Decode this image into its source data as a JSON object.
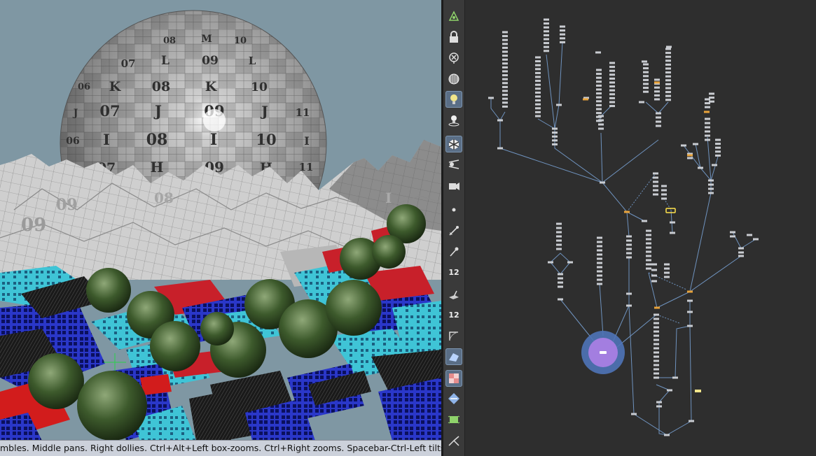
{
  "viewport": {
    "status_text": "mbles. Middle pans. Right dollies. Ctrl+Alt+Left box-zooms. Ctrl+Right zooms. Spacebar-Ctrl-Left tilts. Hold",
    "sky_color": "#7f97a3",
    "sphere_labels": [
      [
        "06",
        "K",
        "08",
        "K",
        "10"
      ],
      [
        "07",
        "L",
        "09",
        "L"
      ],
      [
        "J",
        "07",
        "J",
        "09",
        "J",
        "11"
      ],
      [
        "06",
        "I",
        "08",
        "I",
        "10",
        "I"
      ],
      [
        "07",
        "H",
        "09",
        "H",
        "11"
      ],
      [
        "08",
        "M",
        "10"
      ]
    ]
  },
  "toolbar": {
    "tools": [
      {
        "icon": "geometry-view-icon",
        "active": false
      },
      {
        "icon": "lock-camera-icon",
        "active": false
      },
      {
        "icon": "delete-camera-icon",
        "active": false
      },
      {
        "icon": "ghost-shading-icon",
        "active": false
      },
      {
        "icon": "headlight-icon",
        "active": true
      },
      {
        "icon": "light-display-icon",
        "active": false
      },
      {
        "icon": "shading-mode-icon",
        "active": true
      },
      {
        "icon": "camera-view-icon",
        "active": false
      },
      {
        "icon": "render-view-icon",
        "active": false
      },
      {
        "icon": "point-display-icon",
        "active": false
      },
      {
        "icon": "normal-display-icon",
        "active": false
      },
      {
        "icon": "vertex-normal-icon",
        "active": false
      },
      {
        "icon": "point-numbers-icon",
        "label": "12",
        "active": false
      },
      {
        "icon": "primitive-normal-icon",
        "active": false
      },
      {
        "icon": "primitive-numbers-icon",
        "label": "12",
        "active": false
      },
      {
        "icon": "hull-display-icon",
        "active": false
      },
      {
        "icon": "uv-display-icon",
        "active": true
      },
      {
        "icon": "texture-checker-icon",
        "active": true
      },
      {
        "icon": "snap-icon",
        "active": false
      },
      {
        "icon": "template-icon",
        "active": false
      },
      {
        "icon": "handle-icon",
        "active": false
      }
    ]
  },
  "network": {
    "background": "#2e2e2e",
    "wire_color": "#6f93bf",
    "node_color": "#c9ccd1",
    "highlight_color": "#e8a33a",
    "selected_color": "#ffe34d",
    "display_flag_color": "#8b6fd6"
  }
}
